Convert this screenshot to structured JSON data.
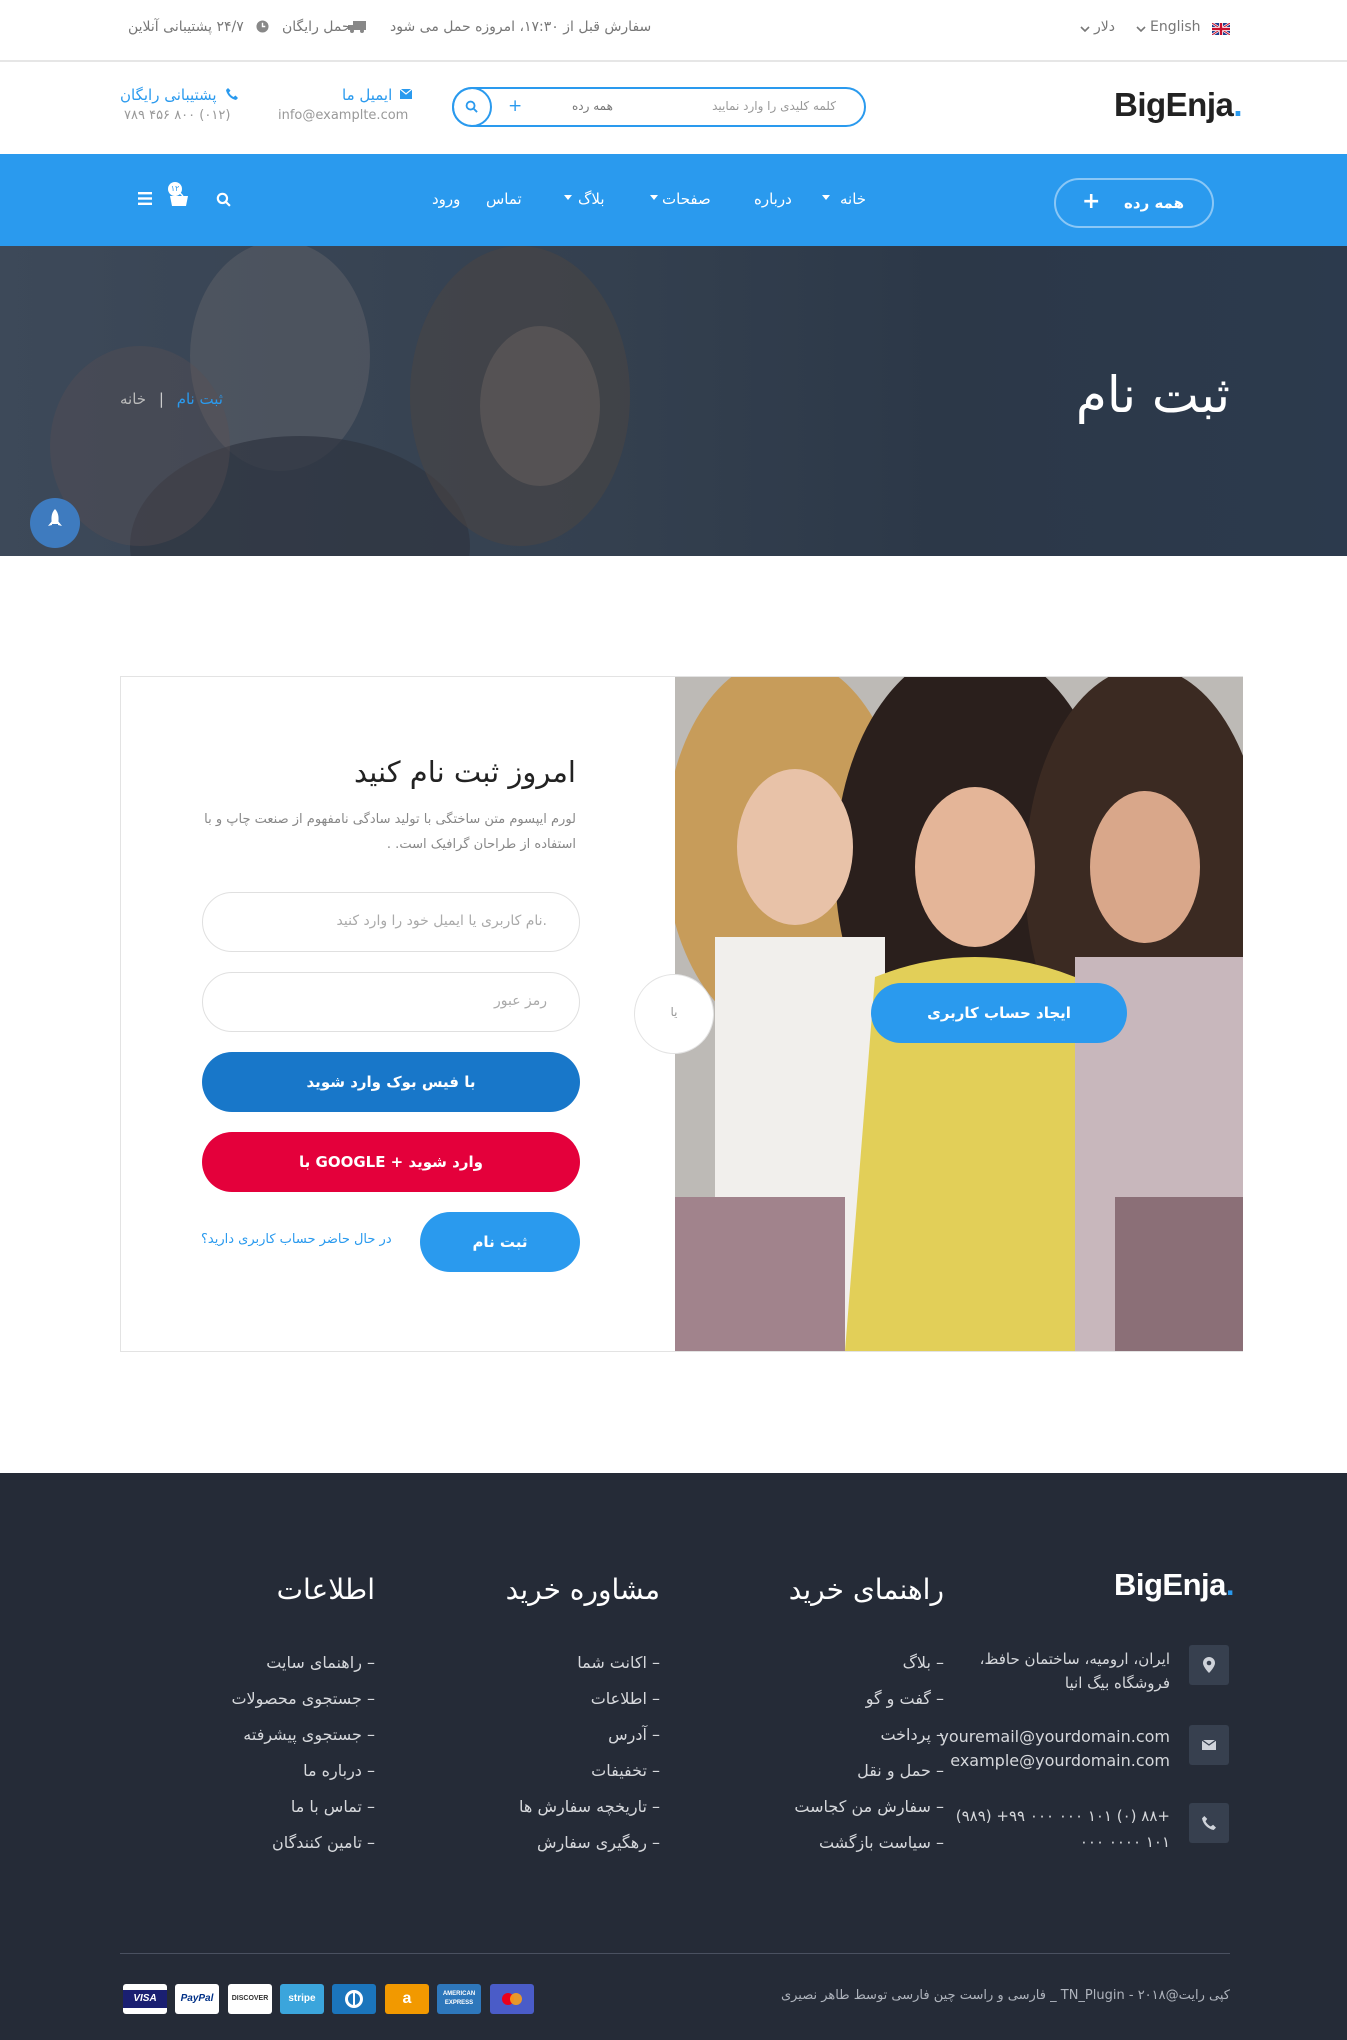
{
  "topbar": {
    "language": "English",
    "currency": "دلار",
    "order_notice": "سفارش قبل از ۱۷:۳۰، امروزه حمل می شود",
    "free_shipping": "حمل رایگان",
    "support": "۲۴/۷ پشتیبانی آنلاین"
  },
  "header": {
    "logo_text": "BigEnja",
    "logo_dot": ".",
    "search_placeholder": "کلمه کلیدی را وارد نمایید",
    "search_category": "همه رده",
    "email_label": "ایمیل ما",
    "email_value": "info@examplte.com",
    "support_label": "پشتیبانی رایگان",
    "support_phone": "(۰۱۲) ۸۰۰ ۴۵۶ ۷۸۹"
  },
  "nav": {
    "category_button": "همه رده",
    "items": [
      "خانه",
      "درباره",
      "صفحات",
      "بلاگ",
      "تماس",
      "ورود"
    ],
    "cart_count": "۱۲"
  },
  "hero": {
    "title": "ثبت نام",
    "breadcrumb_home": "خانه",
    "breadcrumb_sep": "|",
    "breadcrumb_current": "ثبت نام"
  },
  "register": {
    "heading": "امروز ثبت نام کنید",
    "desc_line1": "لورم ایپسوم متن ساختگی با تولید سادگی نامفهوم از صنعت چاپ و با",
    "desc_line2": "استفاده از طراحان گرافیک است. .",
    "username_placeholder": "نام کاربری یا ایمیل خود را وارد کنید.",
    "password_placeholder": "رمز عبور",
    "facebook_button": "با فیس بوک وارد شوید",
    "google_button": "با GOOGLE + وارد شوید",
    "register_button": "ثبت نام",
    "login_link": "در حال حاضر حساب کاربری دارید؟",
    "or_label": "یا",
    "create_account_button": "ایجاد حساب کاربری"
  },
  "footer": {
    "logo_text": "BigEnja",
    "logo_dot": ".",
    "address_line1": "ایران، ارومیه، ساختمان حافظ،",
    "address_line2": "فروشگاه بیگ انیا",
    "email1": "youremail@yourdomain.com",
    "email2": "example@yourdomain.com",
    "phone1": "+۸۸ (۰) ۱۰۱ ۰۰۰ ۰۰۰ ۹۹+ (۹۸۹)",
    "phone2": "۱۰۱ ۰۰۰۰ ۰۰۰",
    "col1_title": "راهنمای خرید",
    "col1": [
      "– بلاگ",
      "– گفت و گو",
      "– پرداخت",
      "– حمل و نقل",
      "– سفارش من کجاست",
      "– سیاست بازگشت"
    ],
    "col2_title": "مشاوره خرید",
    "col2": [
      "– اکانت شما",
      "– اطلاعات",
      "– آدرس",
      "– تخفیفات",
      "– تاریخچه سفارش ها",
      "– رهگیری سفارش"
    ],
    "col3_title": "اطلاعات",
    "col3": [
      "– راهنمای سایت",
      "– جستجوی محصولات",
      "– جستجوی پیشرفته",
      "– درباره ما",
      "– تماس با ما",
      "– تامین کنندگان"
    ],
    "copyright": "کپی رایت@۲۰۱۸ - TN_Plugin _ فارسی و راست چین فارسی توسط طاهر نصیری",
    "payment_cards": [
      "VISA",
      "PayPal",
      "DISCOVER",
      "stripe",
      "Diners",
      "amazon",
      "AMERICAN EXPRESS",
      "Mastercard"
    ]
  },
  "colors": {
    "accent": "#2a9aee",
    "facebook": "#1877c9",
    "google": "#e4003b",
    "footer_bg": "#252b37",
    "nav_bg": "#2a9aee"
  },
  "icons": [
    "uk-flag-icon",
    "chevron-down-icon",
    "clock-icon",
    "truck-icon",
    "search-icon",
    "plus-icon",
    "envelope-icon",
    "phone-icon",
    "menu-icon",
    "basket-icon",
    "rocket-icon",
    "map-pin-icon"
  ]
}
